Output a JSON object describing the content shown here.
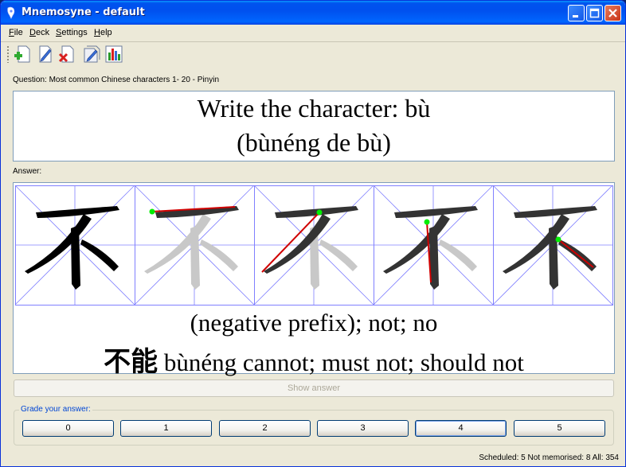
{
  "window": {
    "title": "Mnemosyne - default"
  },
  "menu": [
    {
      "underline": "F",
      "rest": "ile"
    },
    {
      "underline": "D",
      "rest": "eck"
    },
    {
      "underline": "S",
      "rest": "ettings"
    },
    {
      "underline": "H",
      "rest": "elp"
    }
  ],
  "toolbar": {
    "tools": [
      "add-card-icon",
      "edit-card-icon",
      "delete-card-icon",
      "edit-deck-icon",
      "statistics-icon"
    ]
  },
  "question": {
    "label": "Question: Most common Chinese characters    1-  20 - Pinyin",
    "line1": "Write the character: bù",
    "line2": "(bùnéng de bù)"
  },
  "answer": {
    "label": "Answer:",
    "character": "不",
    "meaning": "(negative prefix); not; no",
    "example_chars": "不能",
    "example_text": " bùnéng cannot; must not; should not"
  },
  "show_answer": "Show answer",
  "grade": {
    "title": "Grade your answer:",
    "buttons": [
      "0",
      "1",
      "2",
      "3",
      "4",
      "5"
    ],
    "focused": "4"
  },
  "status": "Scheduled: 5  Not memorised: 8  All: 354",
  "colors": {
    "titlebar": "#0053ee",
    "grid": "#8080ff",
    "stroke_red": "#d00000",
    "stroke_start": "#00ee00"
  }
}
